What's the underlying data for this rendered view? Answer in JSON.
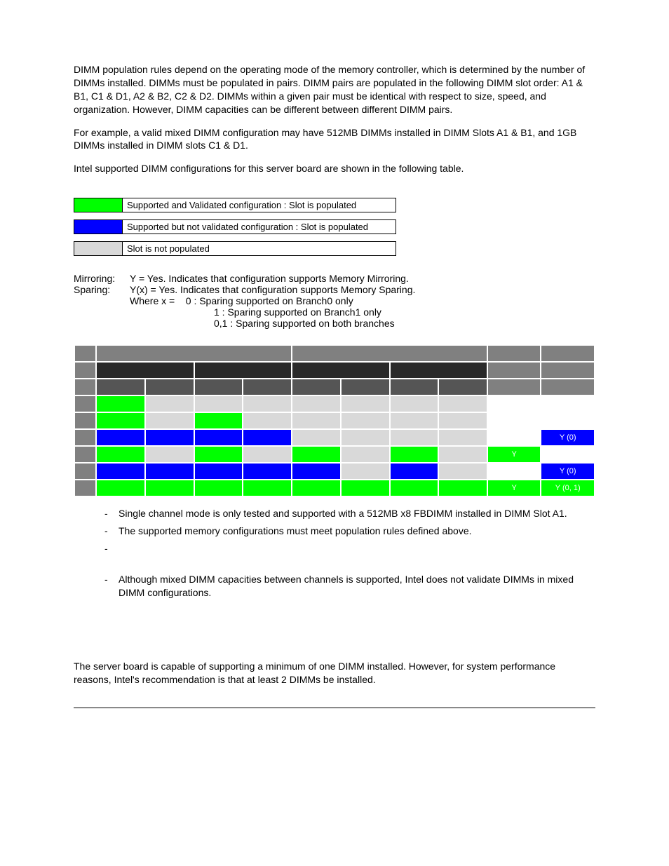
{
  "para1": "DIMM population rules depend on the operating mode of the memory controller, which is determined by the number of DIMMs installed.  DIMMs must be populated in pairs. DIMM pairs are populated in the following DIMM slot order: A1 & B1, C1 & D1, A2 & B2, C2 & D2. DIMMs within a given pair must be identical with respect to size, speed, and organization. However, DIMM capacities can be different between different DIMM pairs.",
  "para2": "For example, a valid mixed DIMM configuration may have 512MB DIMMs installed in DIMM Slots A1 & B1, and 1GB DIMMs installed in DIMM slots C1 & D1.",
  "para3": "Intel supported DIMM configurations for this server board are shown in the following table.",
  "legend": {
    "green": "Supported and Validated configuration : Slot is populated",
    "blue": "Supported but not validated configuration : Slot is populated",
    "grey": "Slot is not populated"
  },
  "defs": {
    "mirror_label": "Mirroring:",
    "mirror_text": "Y = Yes. Indicates that configuration supports Memory Mirroring.",
    "spare_label": "Sparing:",
    "spare_text": "Y(x) = Yes. Indicates that configuration supports Memory Sparing.",
    "where": "Where  x   =",
    "x0": "0 : Sparing supported on Branch0 only",
    "x1": "1 : Sparing supported on Branch1 only",
    "x01": "0,1 : Sparing supported on both branches"
  },
  "table": {
    "row4_sparing": "Y (0)",
    "row5_mirror": "Y",
    "row6_sparing": "Y (0)",
    "row7_mirror": "Y",
    "row7_sparing": "Y (0, 1)"
  },
  "notes": {
    "n1": "Single channel mode is only tested and supported with a 512MB x8 FBDIMM installed in DIMM Slot A1.",
    "n2": "The supported memory configurations must meet population rules defined above.",
    "n3": "",
    "n4": "Although mixed DIMM capacities between channels is supported, Intel does not validate DIMMs in mixed DIMM configurations."
  },
  "para4": "The server board is capable of supporting a minimum of one DIMM installed.  However, for system performance reasons, Intel's recommendation is that at least 2 DIMMs be installed."
}
